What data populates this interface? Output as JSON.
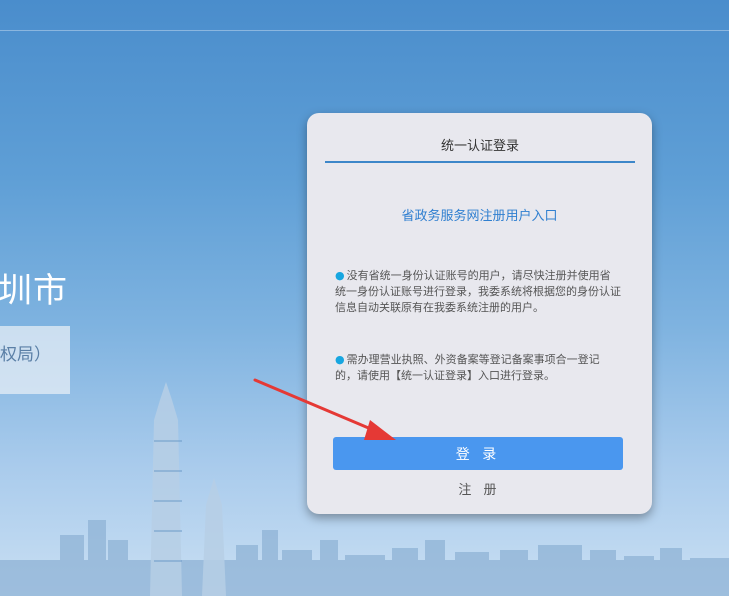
{
  "background": {
    "title": "圳市",
    "subtitle": "权局）"
  },
  "login_card": {
    "tab_label": "统一认证登录",
    "register_link": "省政务服务网注册用户入口",
    "note1": "没有省统一身份认证账号的用户，请尽快注册并使用省统一身份认证账号进行登录，我委系统将根据您的身份认证信息自动关联原有在我委系统注册的用户。",
    "note2": "需办理营业执照、外资备案等登记备案事项合一登记的，请使用【统一认证登录】入口进行登录。",
    "login_label": "登 录",
    "register_label": "注 册"
  },
  "colors": {
    "accent": "#4a97ef",
    "link": "#2f7fd0",
    "arrow": "#e53935",
    "bullet": "#17a6e0"
  },
  "icons": {
    "annotation": "red-arrow-icon",
    "bullet": "bullet-dot-icon"
  }
}
